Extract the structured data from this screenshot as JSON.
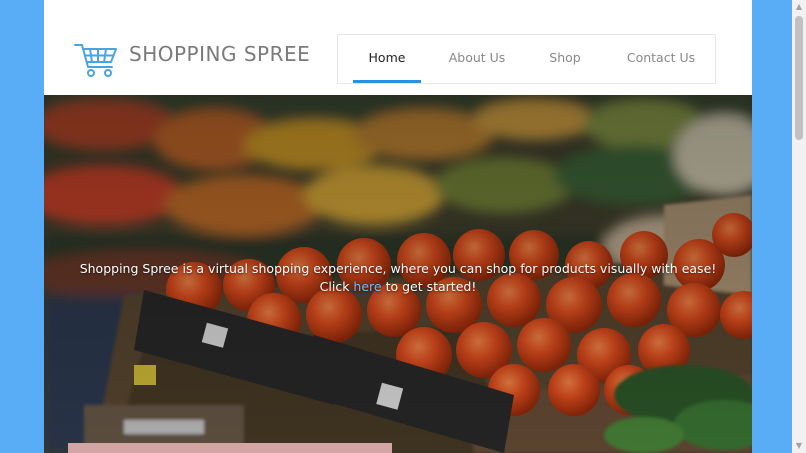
{
  "header": {
    "brand": "SHOPPING SPREE",
    "logo_icon": "shopping-cart-icon",
    "accent_color": "#2b8fde"
  },
  "nav": {
    "items": [
      {
        "label": "Home",
        "active": true
      },
      {
        "label": "About Us",
        "active": false
      },
      {
        "label": "Shop",
        "active": false
      },
      {
        "label": "Contact Us",
        "active": false
      }
    ]
  },
  "hero": {
    "line1": "Shopping Spree is a virtual shopping experience, where you can shop for products visually with ease!",
    "line2_prefix": "Click ",
    "link_text": "here",
    "line2_suffix": " to get started!"
  },
  "colors": {
    "background": "#59adf6",
    "link": "#6bc0ff",
    "pink_bar": "#d4a5a5"
  }
}
